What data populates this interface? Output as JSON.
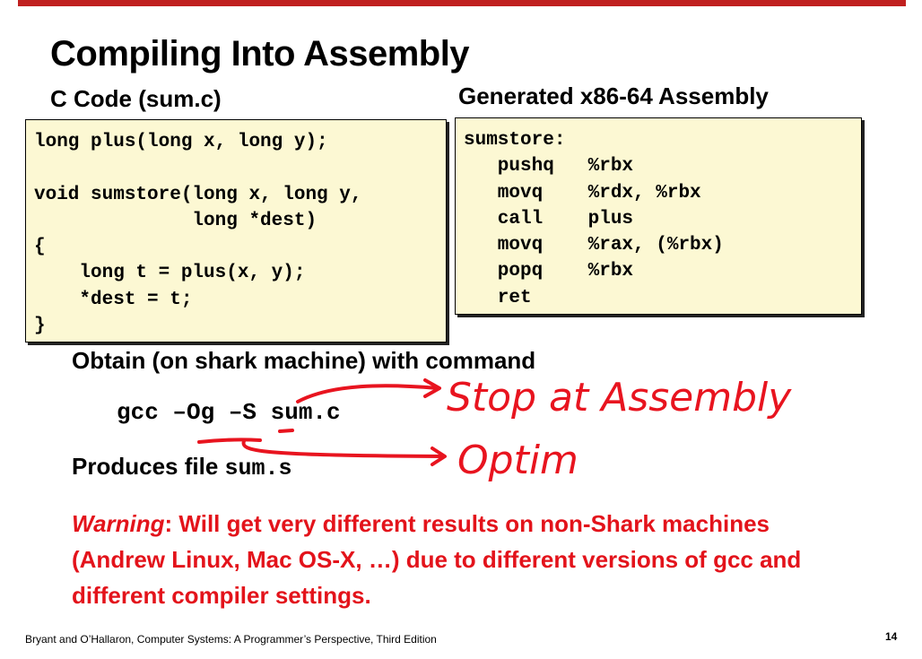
{
  "slide": {
    "title": "Compiling Into Assembly",
    "c_label": "C Code (sum.c)",
    "asm_label": "Generated x86-64 Assembly",
    "c_code": "long plus(long x, long y);\n\nvoid sumstore(long x, long y,\n              long *dest)\n{\n    long t = plus(x, y);\n    *dest = t;\n}",
    "asm_code": "sumstore:\n   pushq   %rbx\n   movq    %rdx, %rbx\n   call    plus\n   movq    %rax, (%rbx)\n   popq    %rbx\n   ret",
    "command_heading": "Obtain (on shark machine) with command",
    "command_line": "gcc –Og –S sum.c",
    "produces_text": "Produces file ",
    "produces_file": "sum.s",
    "warning_word": "Warning",
    "warning_text": ": Will get very different results on non-Shark machines (Andrew Linux, Mac OS-X, …) due to different versions of gcc and different compiler settings.",
    "footer": "Bryant and O’Hallaron, Computer Systems: A Programmer’s Perspective, Third Edition",
    "page_number": "14"
  },
  "annotations": {
    "note_s": "Stop at Assembly",
    "note_og": "Optim",
    "ink_color": "#e8141f"
  }
}
